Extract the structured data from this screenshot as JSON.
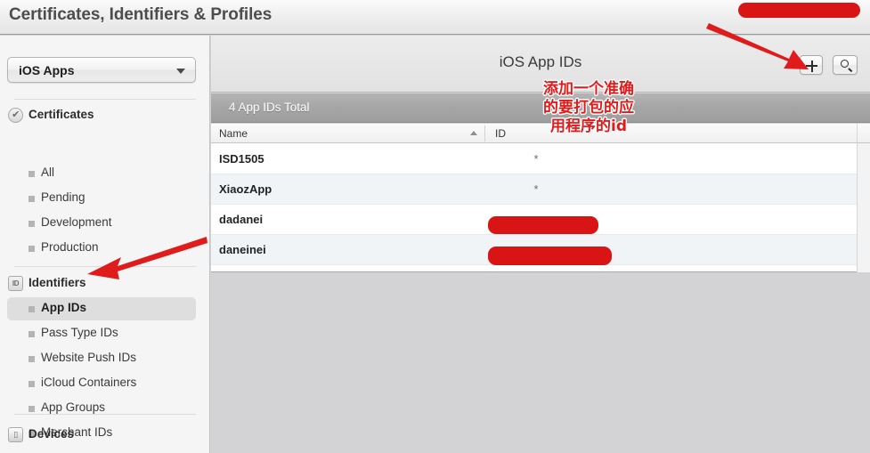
{
  "window": {
    "title": "Certificates, Identifiers & Profiles"
  },
  "sidebar": {
    "org_selector": {
      "value": "iOS Apps",
      "icon": "chevron-down-icon"
    },
    "groups": [
      {
        "label": "Certificates",
        "icon": "certificate-rosette-icon",
        "icon_glyph": "✔",
        "items": [
          {
            "label": "All",
            "selected": false
          },
          {
            "label": "Pending",
            "selected": false
          },
          {
            "label": "Development",
            "selected": false
          },
          {
            "label": "Production",
            "selected": false
          }
        ]
      },
      {
        "label": "Identifiers",
        "icon": "identifier-id-icon",
        "icon_glyph": "ID",
        "items": [
          {
            "label": "App IDs",
            "selected": true
          },
          {
            "label": "Pass Type IDs",
            "selected": false
          },
          {
            "label": "Website Push IDs",
            "selected": false
          },
          {
            "label": "iCloud Containers",
            "selected": false
          },
          {
            "label": "App Groups",
            "selected": false
          },
          {
            "label": "Merchant IDs",
            "selected": false
          }
        ]
      },
      {
        "label": "Devices",
        "icon": "device-phone-icon",
        "icon_glyph": "▯",
        "items": []
      }
    ]
  },
  "main": {
    "header": {
      "title": "iOS App IDs",
      "add_button": {
        "name": "add-icon",
        "glyph": "+"
      },
      "search_button": {
        "name": "search-icon",
        "glyph": "⌕"
      }
    },
    "total_bar": {
      "text": "4 App IDs Total"
    },
    "table": {
      "columns": [
        {
          "key": "name",
          "label": "Name",
          "sorted": "asc"
        },
        {
          "key": "id",
          "label": "ID",
          "sorted": "none"
        }
      ],
      "rows": [
        {
          "name": "ISD1505",
          "id": "*",
          "redacted": false
        },
        {
          "name": "XiaozApp",
          "id": "*",
          "redacted": false
        },
        {
          "name": "dadanei",
          "id": "",
          "redacted": true
        },
        {
          "name": "daneinei",
          "id": "",
          "redacted": true
        }
      ]
    }
  },
  "annotations": {
    "color": "#e01b1b",
    "note_lines": "添加一个准确\n的要打包的应\n用程序的id",
    "arrow_to_add_button": "arrow-icon",
    "arrow_to_app_ids": "arrow-icon",
    "redaction_top": "redaction-bar",
    "redaction_rows": "redaction-bar"
  }
}
